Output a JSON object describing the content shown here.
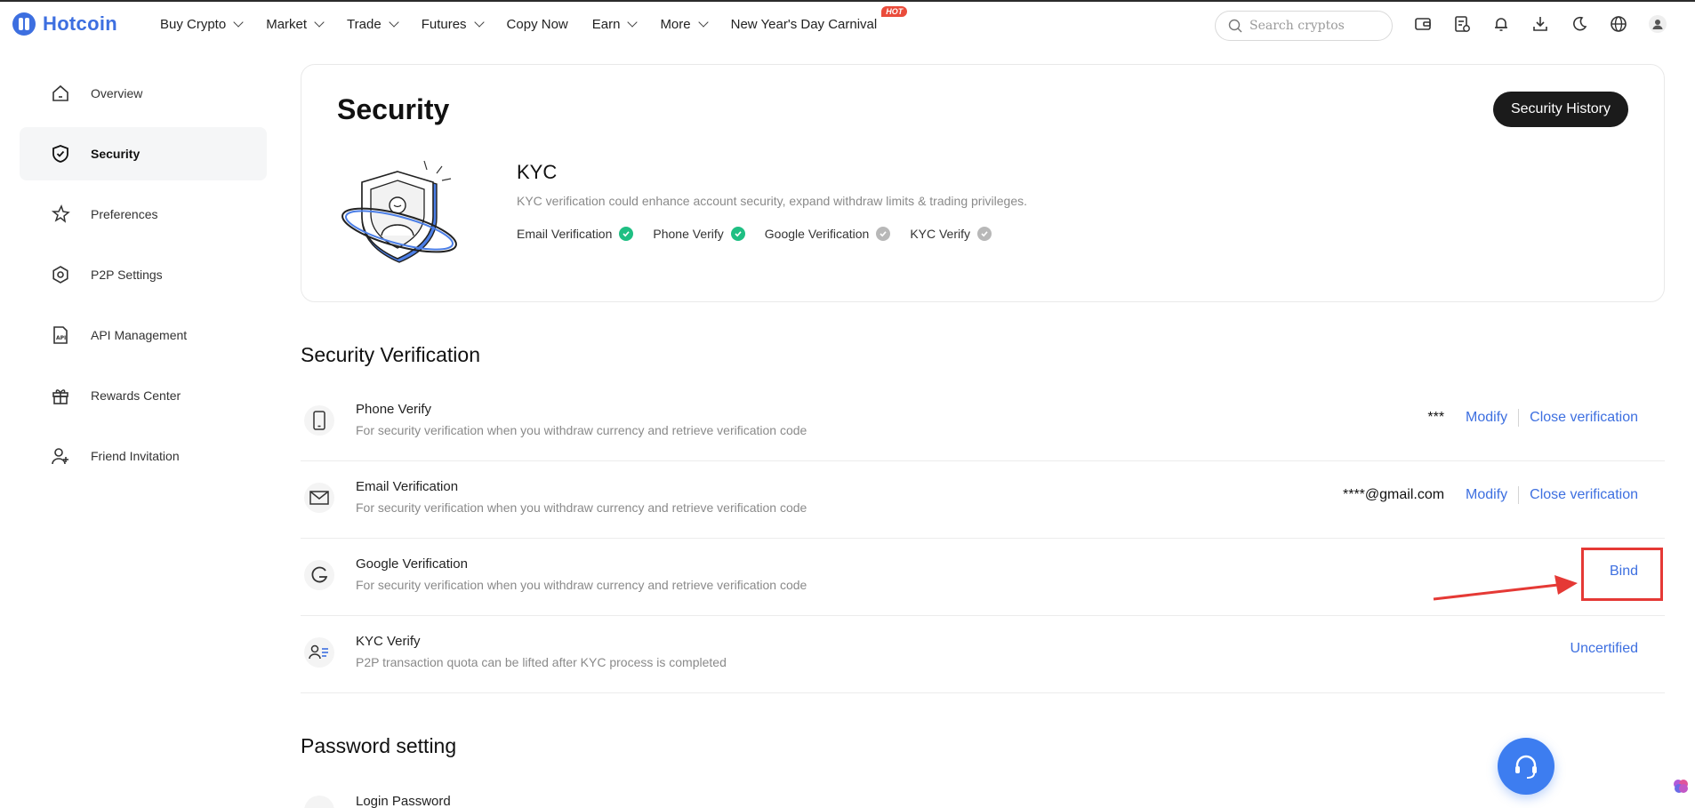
{
  "brand": {
    "name": "Hotcoin",
    "color": "#3d6fe0"
  },
  "nav": {
    "items": [
      {
        "label": "Buy Crypto",
        "dropdown": true
      },
      {
        "label": "Market",
        "dropdown": true
      },
      {
        "label": "Trade",
        "dropdown": true
      },
      {
        "label": "Futures",
        "dropdown": true
      },
      {
        "label": "Copy Now",
        "dropdown": false
      },
      {
        "label": "Earn",
        "dropdown": true
      },
      {
        "label": "More",
        "dropdown": true
      },
      {
        "label": "New Year's Day Carnival",
        "dropdown": false,
        "badge": "HOT"
      }
    ]
  },
  "search": {
    "placeholder": "Search cryptos"
  },
  "top_icons": [
    "wallet-icon",
    "orders-icon",
    "bell-icon",
    "download-icon",
    "moon-icon",
    "globe-icon",
    "user-icon"
  ],
  "sidebar": {
    "items": [
      {
        "label": "Overview",
        "icon": "home-icon",
        "active": false
      },
      {
        "label": "Security",
        "icon": "shield-icon",
        "active": true
      },
      {
        "label": "Preferences",
        "icon": "sparkle-icon",
        "active": false
      },
      {
        "label": "P2P Settings",
        "icon": "gear-icon",
        "active": false
      },
      {
        "label": "API Management",
        "icon": "api-doc-icon",
        "active": false
      },
      {
        "label": "Rewards Center",
        "icon": "gift-icon",
        "active": false
      },
      {
        "label": "Friend Invitation",
        "icon": "add-user-icon",
        "active": false
      }
    ]
  },
  "security_card": {
    "title": "Security",
    "history_button": "Security History",
    "kyc": {
      "title": "KYC",
      "description": "KYC verification could enhance account security, expand withdraw limits & trading privileges.",
      "badges": [
        {
          "label": "Email Verification",
          "verified": true
        },
        {
          "label": "Phone Verify",
          "verified": true
        },
        {
          "label": "Google Verification",
          "verified": false
        },
        {
          "label": "KYC Verify",
          "verified": false
        }
      ]
    }
  },
  "security_verification": {
    "heading": "Security Verification",
    "rows": [
      {
        "title": "Phone Verify",
        "description": "For security verification when you withdraw currency and retrieve verification code",
        "icon": "phone-icon",
        "value": "***",
        "actions": [
          "Modify",
          "Close verification"
        ]
      },
      {
        "title": "Email Verification",
        "description": "For security verification when you withdraw currency and retrieve verification code",
        "icon": "mail-icon",
        "value": "****@gmail.com",
        "actions": [
          "Modify",
          "Close verification"
        ]
      },
      {
        "title": "Google Verification",
        "description": "For security verification when you withdraw currency and retrieve verification code",
        "icon": "google-icon",
        "actions": [
          "Bind"
        ],
        "highlighted": true
      },
      {
        "title": "KYC Verify",
        "description": "P2P transaction quota can be lifted after KYC process is completed",
        "icon": "id-card-icon",
        "actions": [
          "Uncertified"
        ]
      }
    ]
  },
  "password_setting": {
    "heading": "Password setting",
    "rows": [
      {
        "title": "Login Password"
      }
    ]
  },
  "colors": {
    "link": "#3d6fe0",
    "verified": "#1fbf83",
    "unverified": "#b8b8b8",
    "highlight": "#e53935",
    "support": "#3d7df0"
  }
}
